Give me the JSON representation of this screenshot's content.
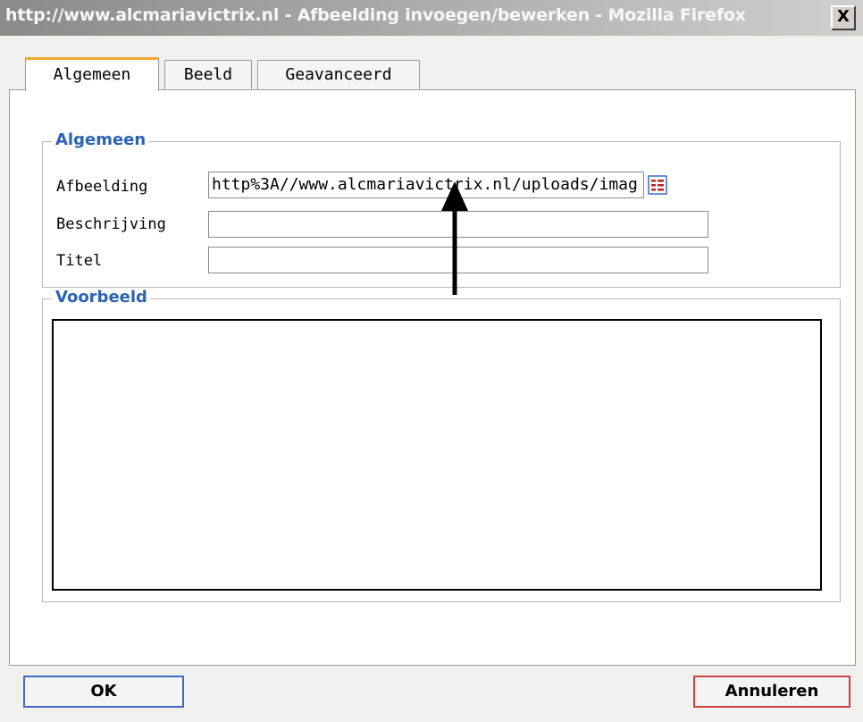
{
  "window": {
    "title": "http://www.alcmariavictrix.nl - Afbeelding invoegen/bewerken - Mozilla Firefox",
    "close_label": "X"
  },
  "tabs": [
    {
      "label": "Algemeen",
      "active": true
    },
    {
      "label": "Beeld",
      "active": false
    },
    {
      "label": "Geavanceerd",
      "active": false
    }
  ],
  "general_section": {
    "legend": "Algemeen",
    "fields": {
      "image": {
        "label": "Afbeelding",
        "value": "http%3A//www.alcmariavictrix.nl/uploads/imag"
      },
      "description": {
        "label": "Beschrijving",
        "value": ""
      },
      "title": {
        "label": "Titel",
        "value": ""
      }
    },
    "browse_icon": "browse-list-icon"
  },
  "preview_section": {
    "legend": "Voorbeeld"
  },
  "buttons": {
    "ok": "OK",
    "cancel": "Annuleren"
  },
  "annotation": {
    "icon": "up-arrow-icon"
  },
  "colors": {
    "legend": "#2b62b5",
    "active_tab_accent": "#f0a830",
    "ok_border": "#3c6bc4",
    "cancel_border": "#d04040",
    "icon_red": "#c02020"
  }
}
